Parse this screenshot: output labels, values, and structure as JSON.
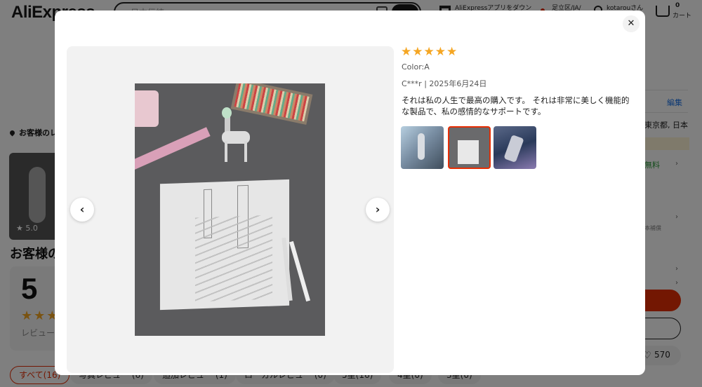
{
  "header": {
    "logo": "AliExpress",
    "search_placeholder": "日本伝統",
    "app_promo": "AliExpressアプリをダウン",
    "location": "足立区/JA/",
    "user": "kotarouさん",
    "cart_count": "0",
    "cart_label": "カート"
  },
  "background": {
    "shipping_heading": "お客様のレ",
    "thumb_rating": "5.0",
    "reviews_heading": "お客様のレ",
    "big_score": "5",
    "review_count_label": "レビュー",
    "edit_link": "編集",
    "address": "東京都, 日本",
    "free_shipping": "無料",
    "small_note": "本補償",
    "wishlist_count": "570",
    "filters": [
      {
        "label": "すべて(16)",
        "active": true
      },
      {
        "label": "写真レビュー (6)",
        "active": false
      },
      {
        "label": "追加レビュー (1)",
        "active": false
      },
      {
        "label": "ローカルレビュー (0)",
        "active": false
      },
      {
        "label": "5星(16)",
        "active": false
      },
      {
        "label": "4星(0)",
        "active": false
      },
      {
        "label": "3星(0)",
        "active": false
      }
    ]
  },
  "modal": {
    "close_icon": "close-icon",
    "stars": "★★★★★",
    "rating": 5,
    "color": "Color:A",
    "meta": "C***r | 2025年6月24日",
    "review_text": "それは私の人生で最高の購入です。 それは非常に美しく機能的な製品で、私の感情的なサポートです。",
    "prev_label": "‹",
    "next_label": "›",
    "thumbnails_selected": 2,
    "accent_color": "#e62e04",
    "star_color": "#f5a623"
  }
}
